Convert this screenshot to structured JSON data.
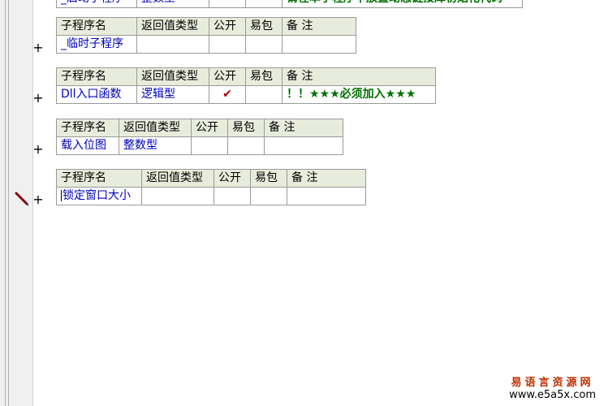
{
  "headers": [
    "子程序名",
    "返回值类型",
    "公开",
    "易包",
    "备 注"
  ],
  "top_partial": {
    "name": "_启动子程序",
    "type": "整数型",
    "note": "请在本子程序中放置动态链接库初始化代码"
  },
  "tables": [
    {
      "name": "_临时子程序",
      "type": "",
      "public": "",
      "note": ""
    },
    {
      "name": "Dll入口函数",
      "type": "逻辑型",
      "public": "✔",
      "note": "！！★★★必须加入★★★"
    },
    {
      "name": "载入位图",
      "type": "整数型",
      "public": "",
      "note": ""
    },
    {
      "name": "锁定窗口大小",
      "type": "",
      "public": "",
      "note": ""
    }
  ],
  "expand_symbol": "+",
  "watermark": {
    "cn": "易语言资源网",
    "url": "www.e5a5x.com"
  }
}
